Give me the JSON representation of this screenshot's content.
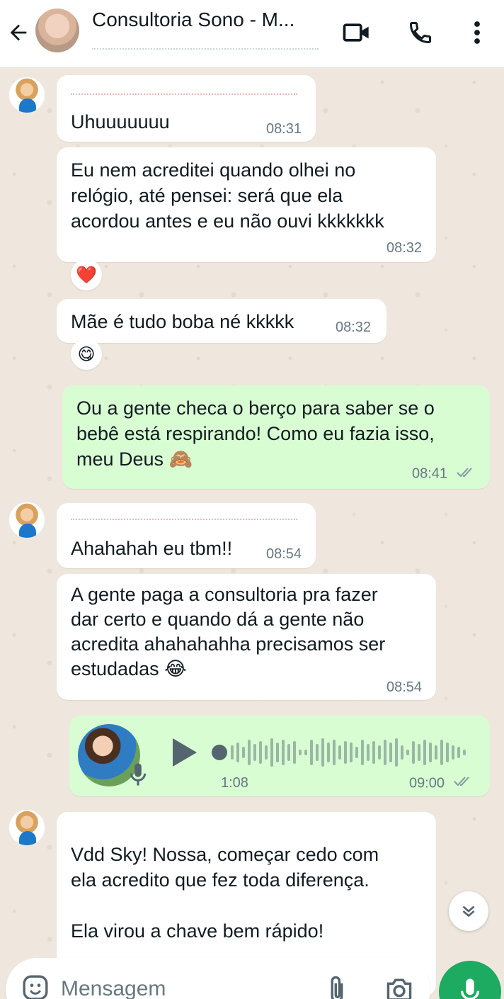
{
  "header": {
    "title": "Consultoria Sono - M...",
    "icons": [
      "back-arrow-icon",
      "video-call-icon",
      "phone-call-icon",
      "more-options-icon"
    ]
  },
  "messages": [
    {
      "text": "Uhuuuuuuu",
      "time": "08:31",
      "direction": "in"
    },
    {
      "text": "Eu nem acreditei quando olhei no\nrelógio, até pensei: será que ela\nacordou antes e eu não ouvi kkkkkkk",
      "time": "08:32",
      "direction": "in",
      "reaction": "❤️"
    },
    {
      "text": "Mãe é tudo boba né kkkkk",
      "time": "08:32",
      "direction": "in",
      "reaction": "😋"
    },
    {
      "text": "Ou a gente checa o berço para saber se o\nbebê está respirando! Como eu fazia isso,\nmeu Deus 🙈",
      "time": "08:41",
      "direction": "out"
    },
    {
      "text": "Ahahahah eu tbm!!",
      "time": "08:54",
      "direction": "in"
    },
    {
      "text": "A gente paga a consultoria pra fazer\ndar certo e quando dá a gente não\nacredita ahahahahha precisamos ser\nestudadas 😂",
      "time": "08:54",
      "direction": "in"
    },
    {
      "type": "voice",
      "duration": "1:08",
      "time": "09:00",
      "direction": "out"
    },
    {
      "text": "Vdd Sky! Nossa, começar cedo com\nela acredito que fez toda diferença.\n\nEla virou a chave bem rápido!",
      "direction": "in"
    }
  ],
  "composer": {
    "placeholder": "Mensagem"
  },
  "colors": {
    "incoming": "#ffffff",
    "outgoing": "#d9fdd3",
    "accent": "#1daa61",
    "chat_bg": "#efe7de"
  }
}
